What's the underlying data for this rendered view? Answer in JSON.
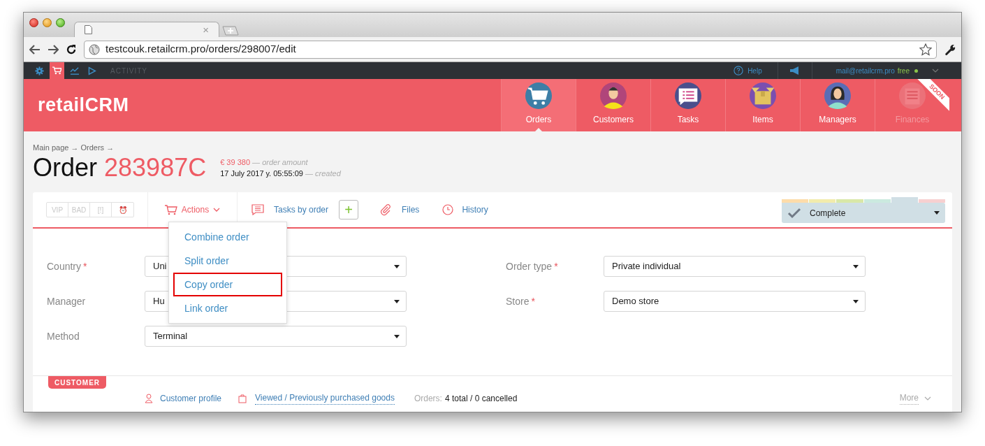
{
  "browser": {
    "tab_close": "×",
    "url": "testcouk.retailcrm.pro/orders/298007/edit"
  },
  "topbar": {
    "items": [
      {
        "kind": "gear",
        "selected": false
      },
      {
        "kind": "cart",
        "selected": true
      },
      {
        "kind": "chart",
        "selected": false
      },
      {
        "kind": "play",
        "selected": false
      }
    ],
    "activity": "ACTIVITY",
    "help": "Help",
    "email": "mail@retailcrm.pro",
    "plan": "free"
  },
  "header": {
    "logo": "retailCRM",
    "nav": [
      {
        "label": "Orders",
        "kind": "cart",
        "selected": true,
        "disabled": false
      },
      {
        "label": "Customers",
        "kind": "person",
        "selected": false,
        "disabled": false
      },
      {
        "label": "Tasks",
        "kind": "tasks",
        "selected": false,
        "disabled": false
      },
      {
        "label": "Items",
        "kind": "box",
        "selected": false,
        "disabled": false
      },
      {
        "label": "Managers",
        "kind": "person2",
        "selected": false,
        "disabled": false
      },
      {
        "label": "Finances",
        "kind": "finance",
        "selected": false,
        "disabled": true,
        "ribbon": "SOON"
      }
    ]
  },
  "breadcrumb": "Main page → Orders →",
  "order": {
    "label": "Order",
    "number": "283987C",
    "amount": "€ 39 380",
    "amount_note": "— order amount",
    "created": "17 July 2017 у. 05:55:09",
    "created_note": "— created"
  },
  "toolbar": {
    "tags": [
      "VIP",
      "BAD",
      "[!]",
      "⏰"
    ],
    "actions": "Actions",
    "tasks": "Tasks by order",
    "add": "+",
    "files": "Files",
    "history": "History"
  },
  "status": {
    "label": "Complete",
    "segments": [
      {
        "color": "#fddcaa",
        "selected": false
      },
      {
        "color": "#f2ecac",
        "selected": false
      },
      {
        "color": "#d9e8a8",
        "selected": false
      },
      {
        "color": "#cbeadf",
        "selected": false
      },
      {
        "color": "#d0dfe5",
        "selected": true
      },
      {
        "color": "#f7d0d0",
        "selected": false
      }
    ]
  },
  "actions_menu": [
    {
      "label": "Combine order",
      "selected": false
    },
    {
      "label": "Split order",
      "selected": false
    },
    {
      "label": "Copy order",
      "selected": true
    },
    {
      "label": "Link order",
      "selected": false
    }
  ],
  "form": {
    "left": [
      {
        "label": "Country",
        "marker": "*",
        "value": "Uni"
      },
      {
        "label": "Manager",
        "value": "Hu"
      },
      {
        "label": "Method",
        "value": "Terminal"
      }
    ],
    "right": [
      {
        "label": "Order type",
        "marker": "*",
        "value": "Private individual"
      },
      {
        "label": "Store",
        "marker": "*",
        "value": "Demo store"
      }
    ]
  },
  "customer": {
    "badge": "CUSTOMER",
    "profile": "Customer profile",
    "goods": "Viewed / Previously purchased goods",
    "orders_label": "Orders:",
    "orders": "4 total / 0 cancelled",
    "more": "More"
  }
}
